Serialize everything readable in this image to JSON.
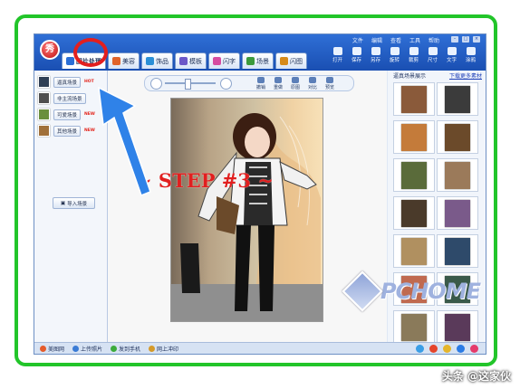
{
  "app": {
    "menu": [
      "文件",
      "编辑",
      "查看",
      "工具",
      "帮助"
    ],
    "tabs": [
      {
        "label": "图片处理",
        "color": "#2b6fd6"
      },
      {
        "label": "美容",
        "color": "#e0632a"
      },
      {
        "label": "饰品",
        "color": "#2b8fd6"
      },
      {
        "label": "模板",
        "color": "#6b58c8"
      },
      {
        "label": "闪字",
        "color": "#d64ca1"
      },
      {
        "label": "场景",
        "color": "#3c9a3c"
      },
      {
        "label": "闪图",
        "color": "#d68a1a"
      }
    ],
    "toolbar": [
      "打开",
      "保存",
      "另存",
      "旋转",
      "裁剪",
      "尺寸",
      "文字",
      "涂鸦"
    ]
  },
  "left_panel": {
    "scenes": [
      {
        "label": "逼真场景",
        "badge": "HOT"
      },
      {
        "label": "非主流场景",
        "badge": ""
      },
      {
        "label": "可爱场景",
        "badge": "NEW"
      },
      {
        "label": "其他场景",
        "badge": "NEW"
      }
    ],
    "import_button": "导入场景"
  },
  "edit_bar": {
    "buttons": [
      "撤销",
      "重做",
      "原图",
      "对比",
      "预览"
    ]
  },
  "canvas": {
    "overlay_text": "~ STEP #3 ~"
  },
  "right_panel": {
    "title": "逼真场景展示",
    "link": "下载更多素材",
    "thumbnail_colors": [
      "#8a5a3a",
      "#3b3b3b",
      "#c47b3a",
      "#6b4a2a",
      "#5a6b3a",
      "#9b7a5a",
      "#4a3a2a",
      "#7a5a8a",
      "#b09060",
      "#2e4a6a",
      "#c06a50",
      "#3a5a4a",
      "#8a7a5a",
      "#5a3a5a",
      "#a07850",
      "#4a6a8a"
    ]
  },
  "status_bar": {
    "items": [
      "美图网",
      "上传照片",
      "发到手机",
      "网上冲印"
    ]
  },
  "watermark": {
    "text": "PCHOME"
  },
  "credit": "头条 @这家伙"
}
